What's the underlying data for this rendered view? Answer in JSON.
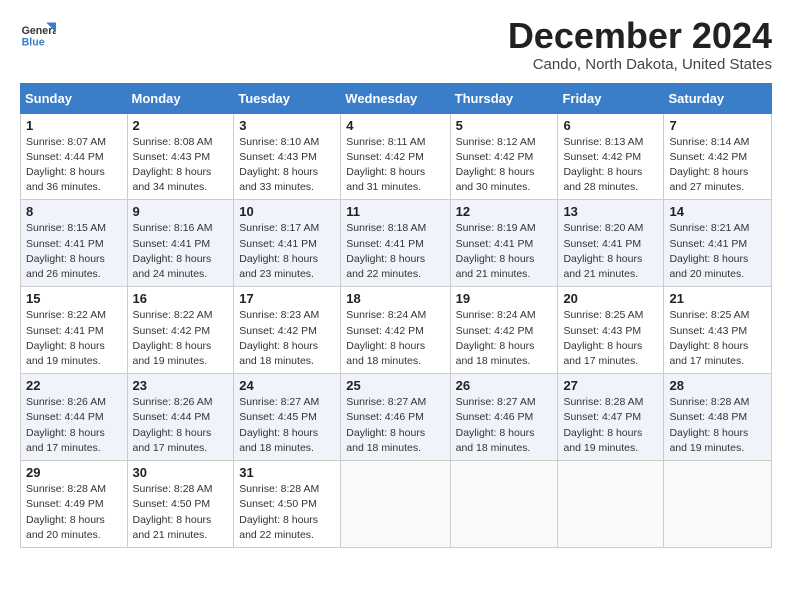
{
  "logo": {
    "general": "General",
    "blue": "Blue"
  },
  "title": "December 2024",
  "location": "Cando, North Dakota, United States",
  "days_of_week": [
    "Sunday",
    "Monday",
    "Tuesday",
    "Wednesday",
    "Thursday",
    "Friday",
    "Saturday"
  ],
  "weeks": [
    [
      {
        "day": "1",
        "text": "Sunrise: 8:07 AM\nSunset: 4:44 PM\nDaylight: 8 hours and 36 minutes."
      },
      {
        "day": "2",
        "text": "Sunrise: 8:08 AM\nSunset: 4:43 PM\nDaylight: 8 hours and 34 minutes."
      },
      {
        "day": "3",
        "text": "Sunrise: 8:10 AM\nSunset: 4:43 PM\nDaylight: 8 hours and 33 minutes."
      },
      {
        "day": "4",
        "text": "Sunrise: 8:11 AM\nSunset: 4:42 PM\nDaylight: 8 hours and 31 minutes."
      },
      {
        "day": "5",
        "text": "Sunrise: 8:12 AM\nSunset: 4:42 PM\nDaylight: 8 hours and 30 minutes."
      },
      {
        "day": "6",
        "text": "Sunrise: 8:13 AM\nSunset: 4:42 PM\nDaylight: 8 hours and 28 minutes."
      },
      {
        "day": "7",
        "text": "Sunrise: 8:14 AM\nSunset: 4:42 PM\nDaylight: 8 hours and 27 minutes."
      }
    ],
    [
      {
        "day": "8",
        "text": "Sunrise: 8:15 AM\nSunset: 4:41 PM\nDaylight: 8 hours and 26 minutes."
      },
      {
        "day": "9",
        "text": "Sunrise: 8:16 AM\nSunset: 4:41 PM\nDaylight: 8 hours and 24 minutes."
      },
      {
        "day": "10",
        "text": "Sunrise: 8:17 AM\nSunset: 4:41 PM\nDaylight: 8 hours and 23 minutes."
      },
      {
        "day": "11",
        "text": "Sunrise: 8:18 AM\nSunset: 4:41 PM\nDaylight: 8 hours and 22 minutes."
      },
      {
        "day": "12",
        "text": "Sunrise: 8:19 AM\nSunset: 4:41 PM\nDaylight: 8 hours and 21 minutes."
      },
      {
        "day": "13",
        "text": "Sunrise: 8:20 AM\nSunset: 4:41 PM\nDaylight: 8 hours and 21 minutes."
      },
      {
        "day": "14",
        "text": "Sunrise: 8:21 AM\nSunset: 4:41 PM\nDaylight: 8 hours and 20 minutes."
      }
    ],
    [
      {
        "day": "15",
        "text": "Sunrise: 8:22 AM\nSunset: 4:41 PM\nDaylight: 8 hours and 19 minutes."
      },
      {
        "day": "16",
        "text": "Sunrise: 8:22 AM\nSunset: 4:42 PM\nDaylight: 8 hours and 19 minutes."
      },
      {
        "day": "17",
        "text": "Sunrise: 8:23 AM\nSunset: 4:42 PM\nDaylight: 8 hours and 18 minutes."
      },
      {
        "day": "18",
        "text": "Sunrise: 8:24 AM\nSunset: 4:42 PM\nDaylight: 8 hours and 18 minutes."
      },
      {
        "day": "19",
        "text": "Sunrise: 8:24 AM\nSunset: 4:42 PM\nDaylight: 8 hours and 18 minutes."
      },
      {
        "day": "20",
        "text": "Sunrise: 8:25 AM\nSunset: 4:43 PM\nDaylight: 8 hours and 17 minutes."
      },
      {
        "day": "21",
        "text": "Sunrise: 8:25 AM\nSunset: 4:43 PM\nDaylight: 8 hours and 17 minutes."
      }
    ],
    [
      {
        "day": "22",
        "text": "Sunrise: 8:26 AM\nSunset: 4:44 PM\nDaylight: 8 hours and 17 minutes."
      },
      {
        "day": "23",
        "text": "Sunrise: 8:26 AM\nSunset: 4:44 PM\nDaylight: 8 hours and 17 minutes."
      },
      {
        "day": "24",
        "text": "Sunrise: 8:27 AM\nSunset: 4:45 PM\nDaylight: 8 hours and 18 minutes."
      },
      {
        "day": "25",
        "text": "Sunrise: 8:27 AM\nSunset: 4:46 PM\nDaylight: 8 hours and 18 minutes."
      },
      {
        "day": "26",
        "text": "Sunrise: 8:27 AM\nSunset: 4:46 PM\nDaylight: 8 hours and 18 minutes."
      },
      {
        "day": "27",
        "text": "Sunrise: 8:28 AM\nSunset: 4:47 PM\nDaylight: 8 hours and 19 minutes."
      },
      {
        "day": "28",
        "text": "Sunrise: 8:28 AM\nSunset: 4:48 PM\nDaylight: 8 hours and 19 minutes."
      }
    ],
    [
      {
        "day": "29",
        "text": "Sunrise: 8:28 AM\nSunset: 4:49 PM\nDaylight: 8 hours and 20 minutes."
      },
      {
        "day": "30",
        "text": "Sunrise: 8:28 AM\nSunset: 4:50 PM\nDaylight: 8 hours and 21 minutes."
      },
      {
        "day": "31",
        "text": "Sunrise: 8:28 AM\nSunset: 4:50 PM\nDaylight: 8 hours and 22 minutes."
      },
      null,
      null,
      null,
      null
    ]
  ]
}
